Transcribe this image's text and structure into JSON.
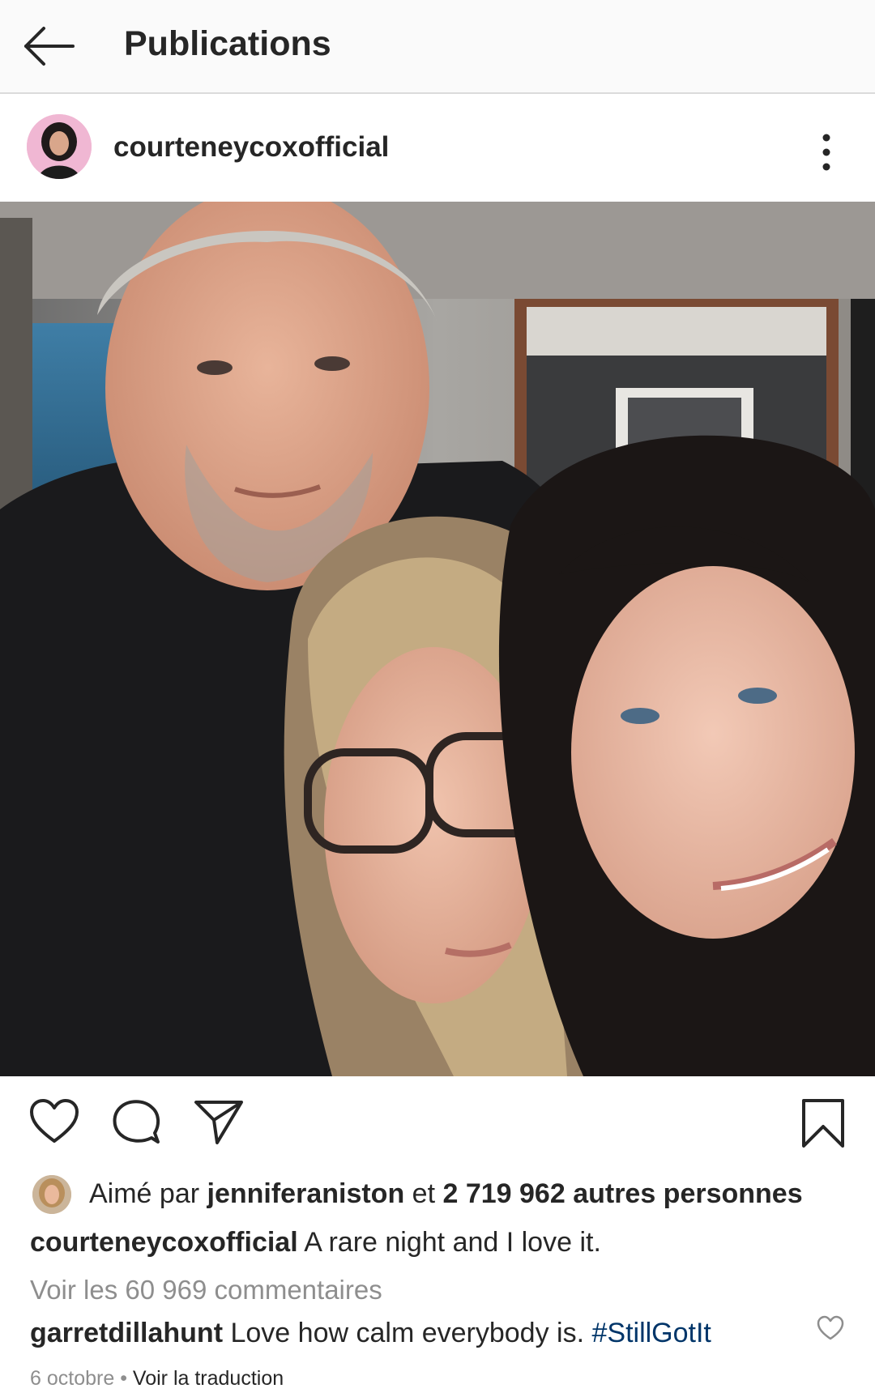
{
  "header": {
    "title": "Publications",
    "back_icon": "arrow-left-icon"
  },
  "post": {
    "username": "courteneycoxofficial",
    "more_icon": "more-vertical-icon",
    "photo_description_icon": "selfie-photo",
    "actions": {
      "like_icon": "heart-icon",
      "comment_icon": "comment-bubble-icon",
      "share_icon": "paper-plane-icon",
      "save_icon": "bookmark-icon"
    },
    "likes": {
      "prefix": "Aimé par",
      "liker": "jenniferaniston",
      "connector": "et",
      "count_text": "2 719 962 autres personnes"
    },
    "caption": {
      "username": "courteneycoxofficial",
      "text": "A rare night and I love it."
    },
    "view_comments": "Voir les 60 969 commentaires",
    "top_comment": {
      "username": "garretdillahunt",
      "text": "Love how calm everybody is.",
      "hashtag": "#StillGotIt"
    },
    "date": "6 octobre",
    "separator": "•",
    "translate": "Voir la traduction"
  },
  "colors": {
    "text": "#262626",
    "muted": "#8e8e8e",
    "link": "#003569",
    "topbar_bg": "#fafafa"
  }
}
